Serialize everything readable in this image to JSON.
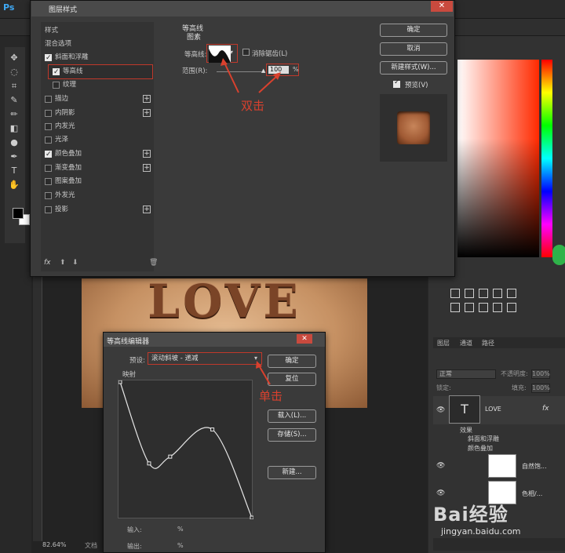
{
  "app": {
    "logo": "Ps"
  },
  "canvas": {
    "artwork_text": "LOVE",
    "zoom": "82.64%",
    "doc_label": "文档"
  },
  "layer_style": {
    "title": "图层样式",
    "style_header": "样式",
    "blend_options": "混合选项",
    "items": [
      {
        "label": "斜面和浮雕",
        "checked": true,
        "plus": false
      },
      {
        "label": "等高线",
        "checked": true,
        "plus": false,
        "selected": true
      },
      {
        "label": "纹理",
        "checked": false,
        "plus": false
      },
      {
        "label": "描边",
        "checked": false,
        "plus": true
      },
      {
        "label": "内阴影",
        "checked": false,
        "plus": true
      },
      {
        "label": "内发光",
        "checked": false,
        "plus": false
      },
      {
        "label": "光泽",
        "checked": false,
        "plus": false
      },
      {
        "label": "颜色叠加",
        "checked": true,
        "plus": true
      },
      {
        "label": "渐变叠加",
        "checked": false,
        "plus": true
      },
      {
        "label": "图案叠加",
        "checked": false,
        "plus": false
      },
      {
        "label": "外发光",
        "checked": false,
        "plus": false
      },
      {
        "label": "投影",
        "checked": false,
        "plus": true
      }
    ],
    "fx_label": "fx",
    "section_title": "等高线",
    "section_sub": "图素",
    "contour_label": "等高线:",
    "antialias_label": "消除锯齿(L)",
    "range_label": "范围(R):",
    "range_value": "100",
    "range_unit": "%",
    "annotation_double_click": "双击",
    "ok": "确定",
    "cancel": "取消",
    "new_style": "新建样式(W)...",
    "preview_label": "预览(V)"
  },
  "contour_editor": {
    "title": "等高线编辑器",
    "preset_label": "预设:",
    "preset_value": "滚动斜坡 - 递减",
    "mapping_label": "映射",
    "annotation_click": "单击",
    "ok": "确定",
    "reset": "复位",
    "load": "载入(L)...",
    "save": "存储(S)...",
    "new": "新建...",
    "input_label": "输入:",
    "output_label": "输出:",
    "percent": "%",
    "curve_points": [
      [
        0,
        100
      ],
      [
        22,
        40
      ],
      [
        38,
        45
      ],
      [
        70,
        65
      ],
      [
        100,
        0
      ]
    ]
  },
  "layers_panel": {
    "tabs": [
      "图层",
      "通道",
      "路径"
    ],
    "mode": "正常",
    "opacity_label": "不透明度:",
    "opacity_value": "100%",
    "lock_label": "锁定:",
    "fill_label": "填充:",
    "fill_value": "100%",
    "layers": [
      {
        "name": "LOVE",
        "fx": "fx"
      },
      {
        "name": "自然饱..."
      },
      {
        "name": "色相/..."
      }
    ],
    "effects_label": "效果",
    "effects": [
      "斜面和浮雕",
      "颜色叠加"
    ]
  },
  "watermark": {
    "brand": "Bai经验",
    "site": "jingyan.baidu.com"
  },
  "colors": {
    "accent_red": "#c0392b",
    "annotation_red": "#d9412e"
  }
}
